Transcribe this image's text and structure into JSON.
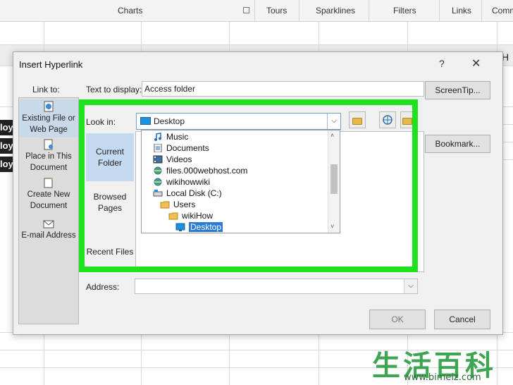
{
  "ribbon": {
    "groups": [
      "Charts",
      "Tours",
      "Sparklines",
      "Filters",
      "Links",
      "Comm"
    ]
  },
  "sheet": {
    "column_letter": "H",
    "cell_fragments": [
      "loy",
      "loy",
      "loy"
    ]
  },
  "dialog": {
    "title": "Insert Hyperlink",
    "help": "?",
    "close": "✕",
    "link_to_label": "Link to:",
    "link_to_items": [
      {
        "label": "Existing File or Web Page",
        "icon": "web-page-icon",
        "selected": true
      },
      {
        "label": "Place in This Document",
        "icon": "document-place-icon",
        "selected": false
      },
      {
        "label": "Create New Document",
        "icon": "new-document-icon",
        "selected": false
      },
      {
        "label": "E-mail Address",
        "icon": "email-icon",
        "selected": false
      }
    ],
    "text_to_display_label": "Text to display:",
    "text_to_display_value": "Access folder",
    "screentip_button": "ScreenTip...",
    "look_in_label": "Look in:",
    "look_in_value": "Desktop",
    "sub_nav": [
      {
        "label": "Current Folder",
        "selected": true
      },
      {
        "label": "Browsed Pages",
        "selected": false
      },
      {
        "label": "Recent Files",
        "selected": false
      }
    ],
    "dropdown_items": [
      {
        "label": "Music",
        "icon": "music-icon",
        "indent": 0,
        "selected": false
      },
      {
        "label": "Documents",
        "icon": "documents-icon",
        "indent": 0,
        "selected": false
      },
      {
        "label": "Videos",
        "icon": "videos-icon",
        "indent": 0,
        "selected": false
      },
      {
        "label": "files.000webhost.com",
        "icon": "globe-icon",
        "indent": 0,
        "selected": false
      },
      {
        "label": "wikihowwiki",
        "icon": "globe-icon",
        "indent": 0,
        "selected": false
      },
      {
        "label": "Local Disk (C:)",
        "icon": "disk-icon",
        "indent": 0,
        "selected": false
      },
      {
        "label": "Users",
        "icon": "folder-icon",
        "indent": 1,
        "selected": false
      },
      {
        "label": "wikiHow",
        "icon": "folder-icon",
        "indent": 2,
        "selected": false
      },
      {
        "label": "Desktop",
        "icon": "desktop-icon",
        "indent": 3,
        "selected": true
      }
    ],
    "bookmark_button": "Bookmark...",
    "address_label": "Address:",
    "address_value": "",
    "ok_button": "OK",
    "cancel_button": "Cancel"
  },
  "watermark": {
    "chars": "生活百科",
    "url": "www.bimeiz.com"
  }
}
